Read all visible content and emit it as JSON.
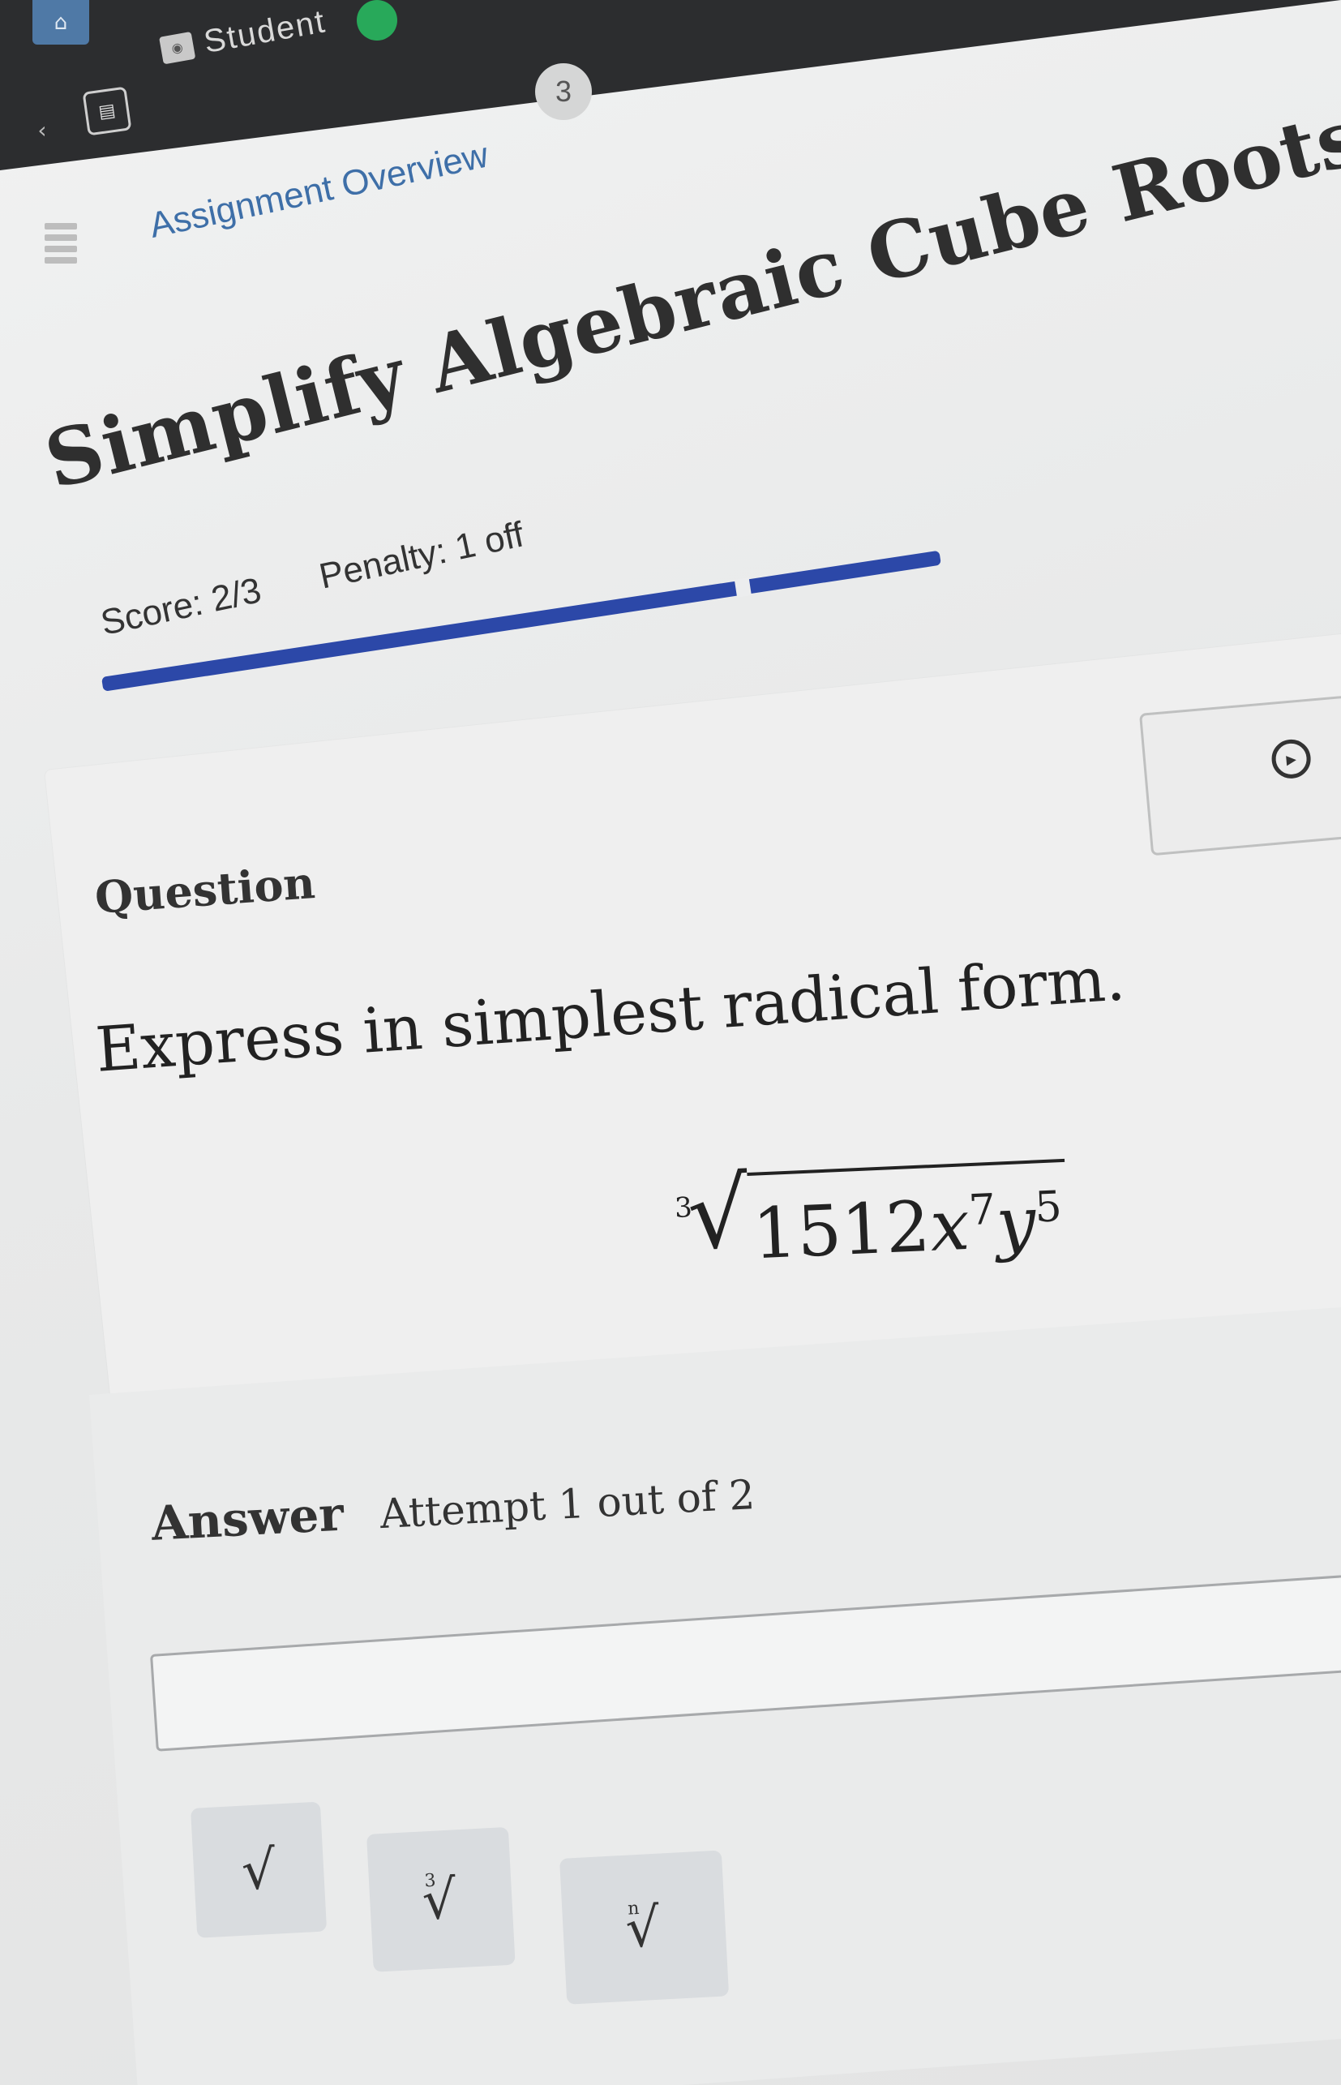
{
  "header": {
    "role_label": "Student",
    "status_badge": "",
    "breadcrumb": "Assignment Overview",
    "badge_count": "3"
  },
  "assignment": {
    "title": "Simplify Algebraic Cube Roots",
    "score": "Score: 2/3",
    "penalty": "Penalty: 1 off",
    "progress": 0.67
  },
  "question": {
    "heading": "Question",
    "prompt": "Express in simplest radical form.",
    "expression": {
      "index": "3",
      "radical_symbol": "√",
      "coefficient": "1512",
      "var1": "x",
      "exp1": "7",
      "var2": "y",
      "exp2": "5"
    }
  },
  "answer": {
    "heading": "Answer",
    "attempt": "Attempt 1 out of 2",
    "input_value": "",
    "buttons": {
      "sqrt": "√",
      "cbrt_index": "3",
      "cbrt": "√",
      "nrt_index": "n",
      "nrt": "√"
    }
  },
  "colors": {
    "accent": "#2c48a8",
    "link": "#3e6fa8",
    "topbar": "#2c2d2f",
    "status": "#28a95a"
  },
  "icons": [
    "home-icon",
    "back-icon",
    "book-icon",
    "student-icon",
    "menu-icon",
    "play-icon"
  ]
}
